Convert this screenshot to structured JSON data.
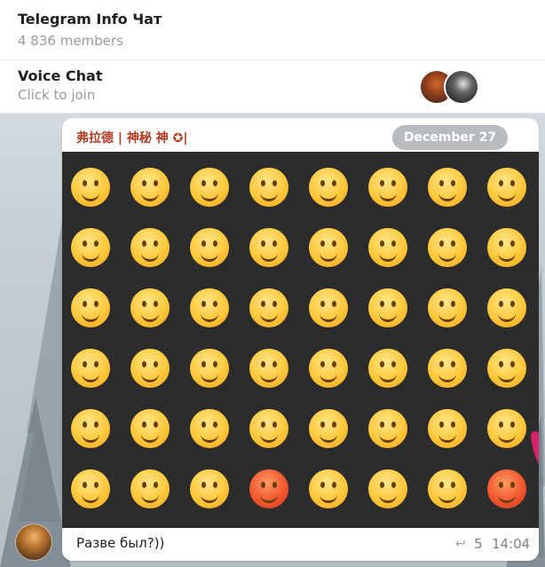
{
  "header": {
    "title": "Telegram Info Чат",
    "members": "4 836 members"
  },
  "voice_chat": {
    "title": "Voice Chat",
    "subtitle": "Click to join"
  },
  "message": {
    "reply_sender": "弗拉德 | 神秘 神 ✪|",
    "date_label": "December 27",
    "text": "Разве был?))",
    "reply_count": "5",
    "time": "14:04"
  },
  "colors": {
    "accent": "#d4236b",
    "reply_sender": "#b23b22",
    "date_pill": "#b8bcc0"
  }
}
